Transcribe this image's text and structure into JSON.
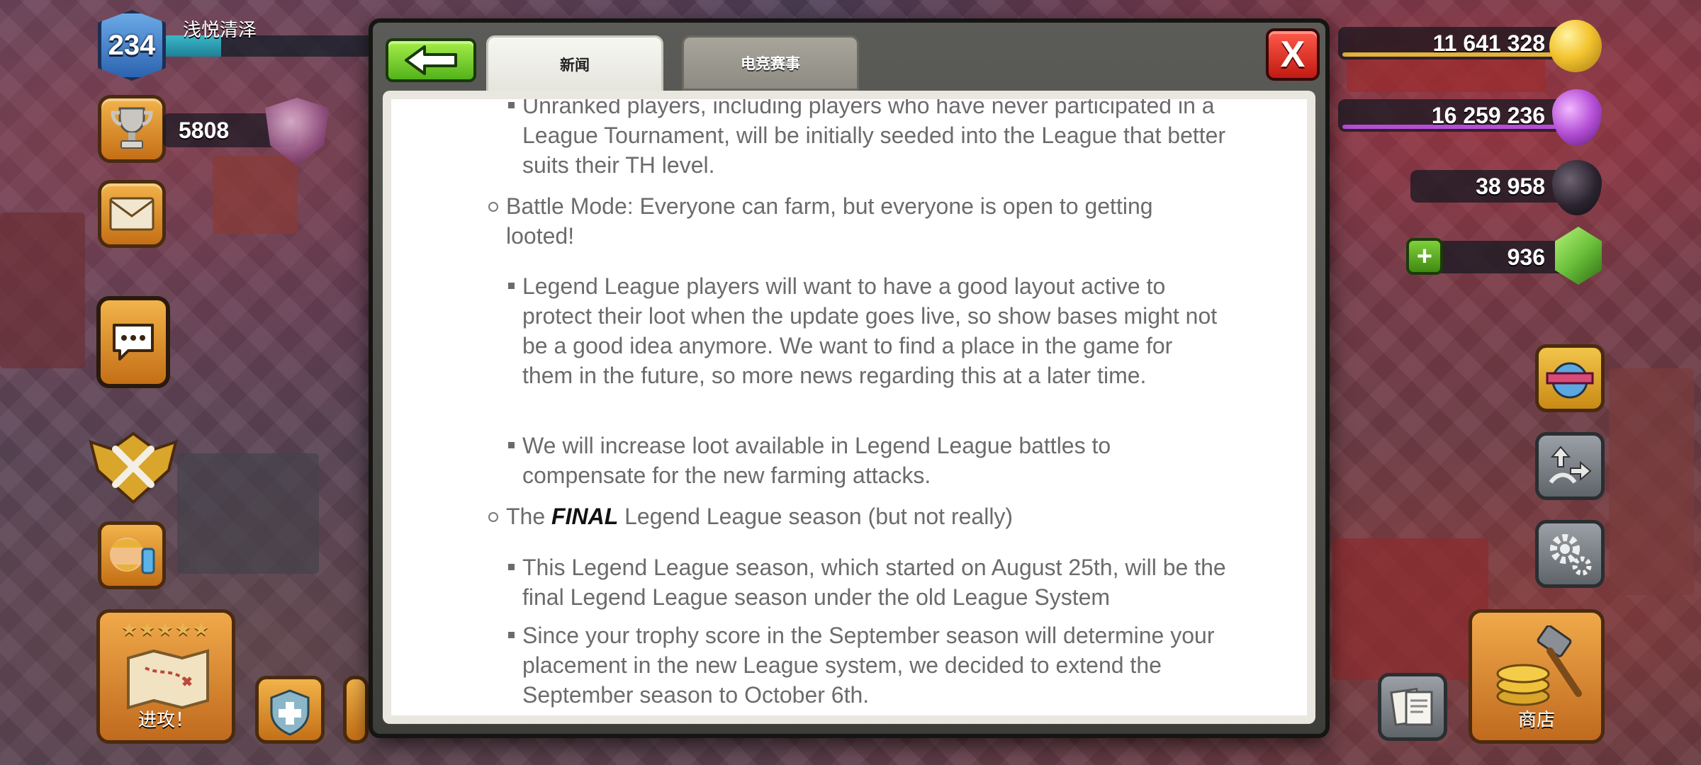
{
  "player": {
    "level": "234",
    "name": "浅悦清泽",
    "trophies": "5808",
    "xp_progress": 0.28
  },
  "resources": {
    "gold": "11 641 328",
    "elixir": "16 259 236",
    "dark_elixir": "38 958",
    "gems": "936"
  },
  "colors": {
    "gold": "#f4c430",
    "elixir": "#b44fd6",
    "dark_elixir": "#2b2430",
    "gems": "#6cc23b"
  },
  "left_buttons": {
    "attack_label": "进攻！",
    "attack_stars": "★★★★★"
  },
  "right_buttons": {
    "shop_label": "商店"
  },
  "modal": {
    "tabs": [
      {
        "label": "新闻",
        "active": true
      },
      {
        "label": "电竞赛事",
        "active": false
      }
    ],
    "close_label": "X"
  },
  "article": {
    "paragraphs": [
      {
        "level": 2,
        "text": "Unranked players, including players who have never participated in a League Tournament, will be initially seeded into the League that better suits their TH level."
      },
      {
        "level": 1,
        "text": "Battle Mode: Everyone can farm, but everyone is open to getting looted!"
      },
      {
        "level": 2,
        "text": "Legend League players will want to have a good layout active to protect their loot when the update goes live, so show bases might not be a good idea anymore. We want to find a place in the game for them in the future, so more news regarding this at a later time."
      },
      {
        "level": 2,
        "text": "We will increase loot available in Legend League battles to compensate for the new farming attacks."
      },
      {
        "level": 1,
        "pre": "The ",
        "emphasis": "FINAL",
        "post": " Legend League season (but not really)"
      },
      {
        "level": 2,
        "text": "This Legend League season, which started on August 25th, will be the final Legend League season under the old League System"
      },
      {
        "level": 2,
        "text": "Since your trophy score in the September season will determine your placement in the new League system, we decided to extend the September season to October 6th."
      }
    ]
  }
}
